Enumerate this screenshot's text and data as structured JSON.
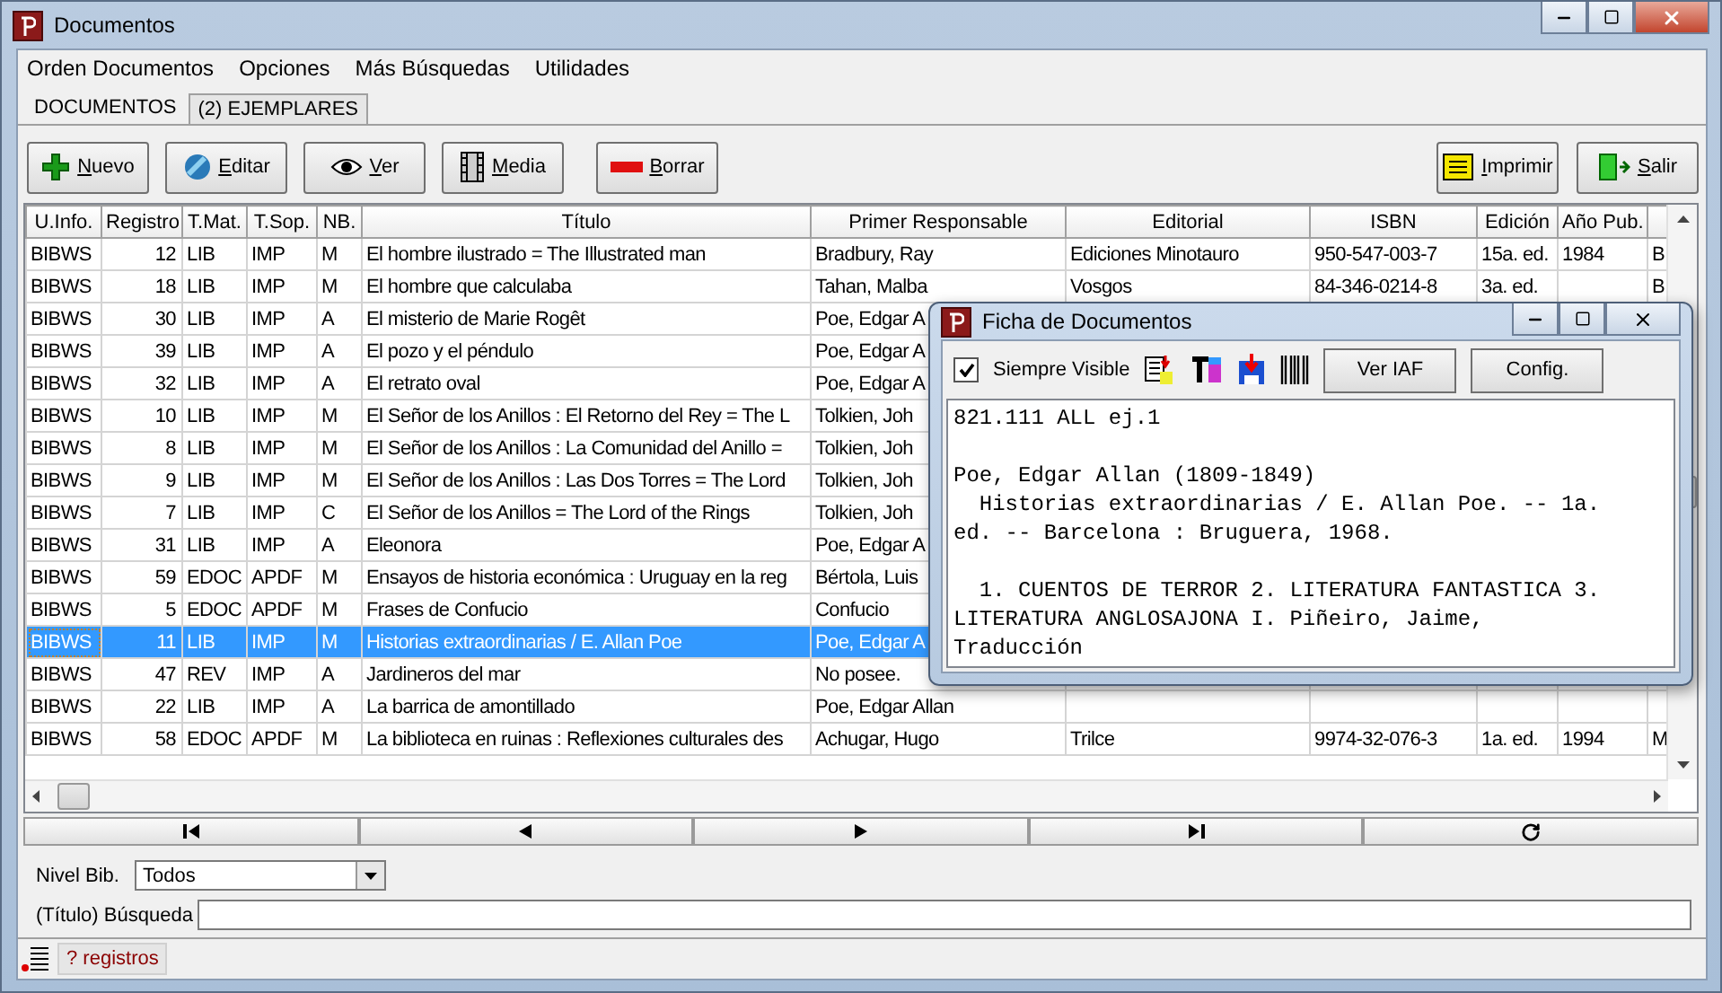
{
  "window": {
    "title": "Documentos"
  },
  "menu": [
    "Orden Documentos",
    "Opciones",
    "Más Búsquedas",
    "Utilidades"
  ],
  "tabs": [
    {
      "label": "DOCUMENTOS",
      "selected": true
    },
    {
      "label": "(2) EJEMPLARES",
      "selected": false
    }
  ],
  "toolbar": {
    "left": [
      {
        "kind": "new",
        "label": "Nuevo"
      },
      {
        "kind": "edit",
        "label": "Editar"
      },
      {
        "kind": "view",
        "label": "Ver"
      },
      {
        "kind": "media",
        "label": "Media"
      },
      {
        "kind": "delete",
        "label": "Borrar"
      }
    ],
    "right": [
      {
        "kind": "print",
        "label": "Imprimir"
      },
      {
        "kind": "exit",
        "label": "Salir"
      }
    ]
  },
  "table": {
    "columns": [
      "U.Info.",
      "Registro",
      "T.Mat.",
      "T.Sop.",
      "NB.",
      "Título",
      "Primer Responsable",
      "Editorial",
      "ISBN",
      "Edición",
      "Año Pub."
    ],
    "rows": [
      {
        "selected": false,
        "cells": [
          "BIBWS",
          "12",
          "LIB",
          "IMP",
          "M",
          "El hombre ilustrado = The Illustrated man",
          "Bradbury, Ray",
          "Ediciones Minotauro",
          "950-547-003-7",
          "15a. ed.",
          "1984",
          "B"
        ]
      },
      {
        "selected": false,
        "cells": [
          "BIBWS",
          "18",
          "LIB",
          "IMP",
          "M",
          "El hombre que calculaba",
          "Tahan, Malba",
          "Vosgos",
          "84-346-0214-8",
          "3a. ed.",
          "",
          "B"
        ]
      },
      {
        "selected": false,
        "cells": [
          "BIBWS",
          "30",
          "LIB",
          "IMP",
          "A",
          "El misterio de Marie Rogêt",
          "Poe, Edgar A"
        ]
      },
      {
        "selected": false,
        "cells": [
          "BIBWS",
          "39",
          "LIB",
          "IMP",
          "A",
          "El pozo y el péndulo",
          "Poe, Edgar A"
        ]
      },
      {
        "selected": false,
        "cells": [
          "BIBWS",
          "32",
          "LIB",
          "IMP",
          "A",
          "El retrato oval",
          "Poe, Edgar A"
        ]
      },
      {
        "selected": false,
        "cells": [
          "BIBWS",
          "10",
          "LIB",
          "IMP",
          "M",
          "El Señor de los Anillos : El Retorno del Rey = The L",
          "Tolkien, Joh"
        ]
      },
      {
        "selected": false,
        "cells": [
          "BIBWS",
          "8",
          "LIB",
          "IMP",
          "M",
          "El Señor de los Anillos : La Comunidad del Anillo =",
          "Tolkien, Joh"
        ]
      },
      {
        "selected": false,
        "cells": [
          "BIBWS",
          "9",
          "LIB",
          "IMP",
          "M",
          "El Señor de los Anillos : Las Dos Torres = The Lord",
          "Tolkien, Joh"
        ]
      },
      {
        "selected": false,
        "cells": [
          "BIBWS",
          "7",
          "LIB",
          "IMP",
          "C",
          "El Señor de los Anillos = The Lord of the Rings",
          "Tolkien, Joh"
        ]
      },
      {
        "selected": false,
        "cells": [
          "BIBWS",
          "31",
          "LIB",
          "IMP",
          "A",
          "Eleonora",
          "Poe, Edgar A"
        ]
      },
      {
        "selected": false,
        "cells": [
          "BIBWS",
          "59",
          "EDOC",
          "APDF",
          "M",
          "Ensayos de historia económica : Uruguay en la reg",
          "Bértola, Luis"
        ]
      },
      {
        "selected": false,
        "cells": [
          "BIBWS",
          "5",
          "EDOC",
          "APDF",
          "M",
          "Frases de Confucio",
          "Confucio"
        ]
      },
      {
        "selected": true,
        "cells": [
          "BIBWS",
          "11",
          "LIB",
          "IMP",
          "M",
          "Historias extraordinarias / E. Allan Poe",
          "Poe, Edgar A"
        ]
      },
      {
        "selected": false,
        "cells": [
          "BIBWS",
          "47",
          "REV",
          "IMP",
          "A",
          "Jardineros del mar",
          "No posee."
        ]
      },
      {
        "selected": false,
        "cells": [
          "BIBWS",
          "22",
          "LIB",
          "IMP",
          "A",
          "La barrica de amontillado",
          "Poe, Edgar Allan"
        ]
      },
      {
        "selected": false,
        "cells": [
          "BIBWS",
          "58",
          "EDOC",
          "APDF",
          "M",
          "La biblioteca en ruinas : Reflexiones culturales des",
          "Achugar, Hugo",
          "Trilce",
          "9974-32-076-3",
          "1a. ed.",
          "1994",
          "M"
        ]
      }
    ]
  },
  "navigation": [
    {
      "kind": "first"
    },
    {
      "kind": "prev"
    },
    {
      "kind": "next"
    },
    {
      "kind": "last"
    },
    {
      "kind": "refresh"
    }
  ],
  "filter": {
    "label": "Nivel Bib.",
    "value": "Todos"
  },
  "search": {
    "label": "(Título) Búsqueda"
  },
  "status": {
    "text": "? registros"
  },
  "dialog": {
    "title": "Ficha de Documentos",
    "always_visible": {
      "label": "Siempre Visible",
      "checked": true
    },
    "tools": [
      {
        "kind": "copy"
      },
      {
        "kind": "format"
      },
      {
        "kind": "save"
      },
      {
        "kind": "barcode"
      }
    ],
    "buttons": [
      "Ver IAF",
      "Config."
    ],
    "record": [
      [
        "821.111 ALL ej.1"
      ],
      [
        "Poe, Edgar Allan (1809-1849)",
        "  Historias extraordinarias / E. Allan Poe. -- 1a.",
        "ed. -- Barcelona : Bruguera, 1968."
      ],
      [
        "  1. CUENTOS DE TERROR 2. LITERATURA FANTASTICA 3.",
        "LITERATURA ANGLOSAJONA I. Piñeiro, Jaime,",
        "Traducción"
      ]
    ]
  }
}
